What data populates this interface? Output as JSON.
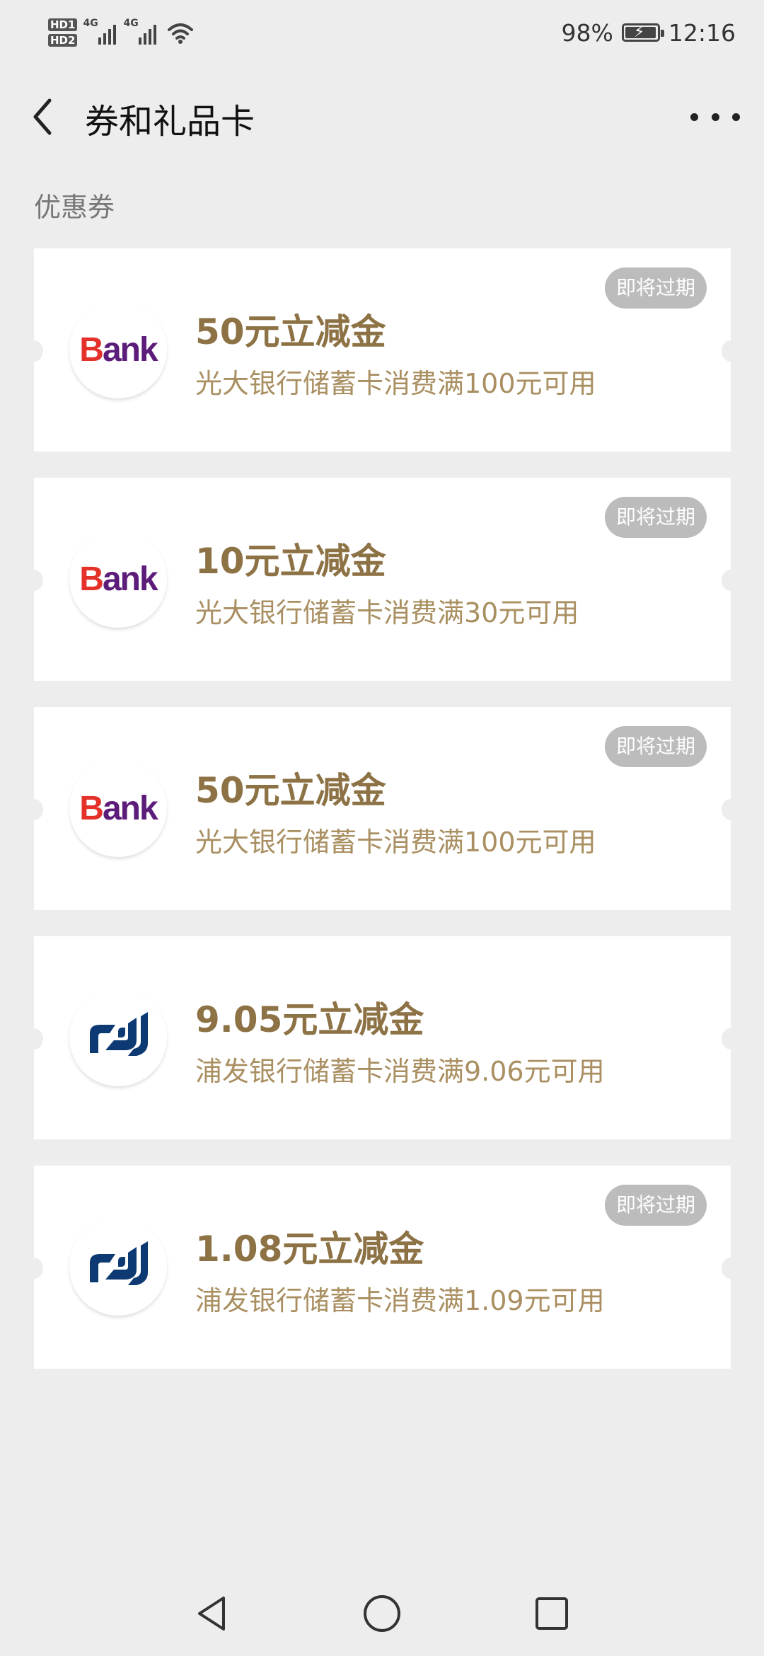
{
  "status_bar": {
    "hd1": "HD1",
    "hd2": "HD2",
    "network_1": "4G",
    "network_2": "4G",
    "battery_percent": "98%",
    "battery_level": 0.98,
    "time": "12:16"
  },
  "nav": {
    "title": "券和礼品卡"
  },
  "section_title": "优惠券",
  "coupons": [
    {
      "amount": "50元立减金",
      "description": "光大银行储蓄卡消费满100元可用",
      "badge": "即将过期",
      "bank_logo": "ceb-bank-logo"
    },
    {
      "amount": "10元立减金",
      "description": "光大银行储蓄卡消费满30元可用",
      "badge": "即将过期",
      "bank_logo": "ceb-bank-logo"
    },
    {
      "amount": "50元立减金",
      "description": "光大银行储蓄卡消费满100元可用",
      "badge": "即将过期",
      "bank_logo": "ceb-bank-logo"
    },
    {
      "amount": "9.05元立减金",
      "description": "浦发银行储蓄卡消费满9.06元可用",
      "badge": "",
      "bank_logo": "spdb-logo"
    },
    {
      "amount": "1.08元立减金",
      "description": "浦发银行储蓄卡消费满1.09元可用",
      "badge": "即将过期",
      "bank_logo": "spdb-logo"
    }
  ],
  "logo_text": {
    "ceb_b": "B",
    "ceb_rest": "ank"
  },
  "colors": {
    "background": "#ededed",
    "amount": "#8c7244",
    "description": "#a98f61",
    "badge": "#bcbcbc",
    "spdb_blue": "#0d3a73",
    "ceb_red": "#e4322b",
    "ceb_purple": "#5c1c7a"
  },
  "icons": {
    "back": "chevron-left-icon",
    "more": "more-dots-icon",
    "sys_back": "triangle-back-icon",
    "sys_home": "circle-home-icon",
    "sys_recent": "square-recent-icon"
  }
}
